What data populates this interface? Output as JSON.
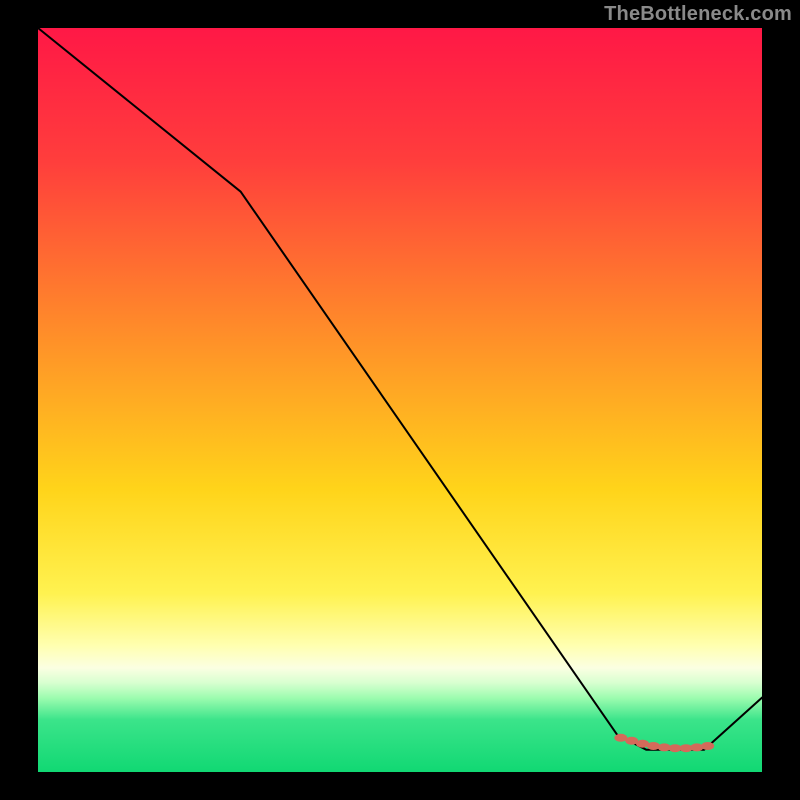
{
  "attribution": "TheBottleneck.com",
  "chart_data": {
    "type": "line",
    "title": "",
    "xlabel": "",
    "ylabel": "",
    "xlim": [
      0,
      100
    ],
    "ylim": [
      0,
      100
    ],
    "background_gradient_stops": [
      {
        "offset": 0,
        "color": "#ff1846"
      },
      {
        "offset": 18,
        "color": "#ff3e3c"
      },
      {
        "offset": 40,
        "color": "#ff8a2a"
      },
      {
        "offset": 62,
        "color": "#ffd41a"
      },
      {
        "offset": 76,
        "color": "#fff250"
      },
      {
        "offset": 83,
        "color": "#ffffb0"
      },
      {
        "offset": 86,
        "color": "#fbffe2"
      },
      {
        "offset": 88,
        "color": "#d8ffd0"
      },
      {
        "offset": 90,
        "color": "#9efcb0"
      },
      {
        "offset": 93,
        "color": "#3be48a"
      },
      {
        "offset": 100,
        "color": "#11d873"
      }
    ],
    "series": [
      {
        "name": "curve",
        "color": "#000000",
        "stroke_width": 2,
        "x": [
          0,
          28,
          80,
          84,
          92,
          100
        ],
        "y": [
          100,
          78,
          5,
          3,
          3,
          10
        ]
      }
    ],
    "markers": {
      "name": "highlight-band",
      "color": "#d46a5a",
      "points": [
        {
          "x": 80.5,
          "y": 4.6
        },
        {
          "x": 82.0,
          "y": 4.2
        },
        {
          "x": 83.5,
          "y": 3.8
        },
        {
          "x": 85.0,
          "y": 3.5
        },
        {
          "x": 86.5,
          "y": 3.3
        },
        {
          "x": 88.0,
          "y": 3.2
        },
        {
          "x": 89.5,
          "y": 3.2
        },
        {
          "x": 91.0,
          "y": 3.3
        },
        {
          "x": 92.5,
          "y": 3.5
        }
      ]
    }
  }
}
